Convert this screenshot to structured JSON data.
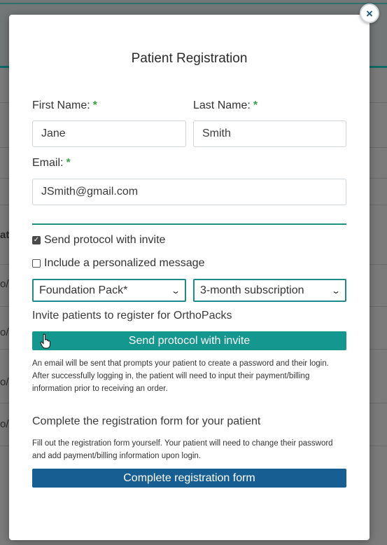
{
  "modal": {
    "title": "Patient Registration",
    "close_label": "×"
  },
  "form": {
    "first_name_label": "First Name:",
    "first_name_value": "Jane",
    "last_name_label": "Last Name:",
    "last_name_value": "Smith",
    "email_label": "Email:",
    "email_value": "JSmith@gmail.com",
    "required_marker": "*"
  },
  "options": {
    "send_protocol_label": "Send protocol with invite",
    "send_protocol_checked": true,
    "personal_message_label": "Include a personalized message",
    "personal_message_checked": false,
    "pack_selected": "Foundation Pack*",
    "subscription_selected": "3-month subscription"
  },
  "invite": {
    "heading": "Invite patients to register for OrthoPacks",
    "button_label": "Send protocol with invite",
    "description": "An email will be sent that prompts your patient to create a password and their login. After successfully logging in, the patient will need to input their payment/billing information prior to receiving an order."
  },
  "complete": {
    "heading": "Complete the registration form for your patient",
    "description": "Fill out the registration form yourself. Your patient will need to change their password and add payment/billing information upon login.",
    "button_label": "Complete registration form"
  },
  "colors": {
    "accent_teal": "#14978e",
    "accent_blue": "#175e92",
    "required_green": "#3aa04a"
  },
  "background": {
    "left_fragments": [
      "ate",
      "o/",
      "o/",
      "o/",
      "o/"
    ]
  }
}
